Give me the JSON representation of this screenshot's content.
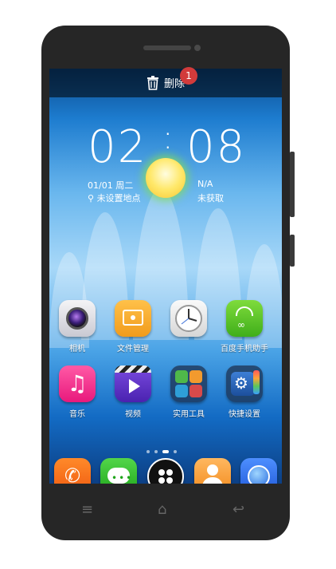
{
  "topbar": {
    "delete_label": "删除",
    "badge_count": "1"
  },
  "clock": {
    "hours": "02",
    "colon": ":",
    "minutes": "08"
  },
  "weather": {
    "date": "01/01 周二",
    "location": "未设置地点",
    "temp": "N/A",
    "status": "未获取"
  },
  "apps_row1": [
    {
      "label": "相机",
      "icon": "camera-icon"
    },
    {
      "label": "文件管理",
      "icon": "folder-icon"
    },
    {
      "label": "",
      "icon": "clock-icon"
    },
    {
      "label": "百度手机助手",
      "icon": "shopping-bag-icon"
    }
  ],
  "apps_row2": [
    {
      "label": "音乐",
      "icon": "music-note-icon"
    },
    {
      "label": "视频",
      "icon": "video-play-icon"
    },
    {
      "label": "实用工具",
      "icon": "tools-icon"
    },
    {
      "label": "快捷设置",
      "icon": "settings-icon"
    }
  ],
  "dock": [
    {
      "icon": "phone-icon"
    },
    {
      "icon": "message-icon"
    },
    {
      "icon": "app-drawer-icon"
    },
    {
      "icon": "contacts-icon"
    },
    {
      "icon": "browser-globe-icon"
    }
  ],
  "nav_keys": {
    "menu": "≡",
    "home": "⌂",
    "back": "↩"
  }
}
